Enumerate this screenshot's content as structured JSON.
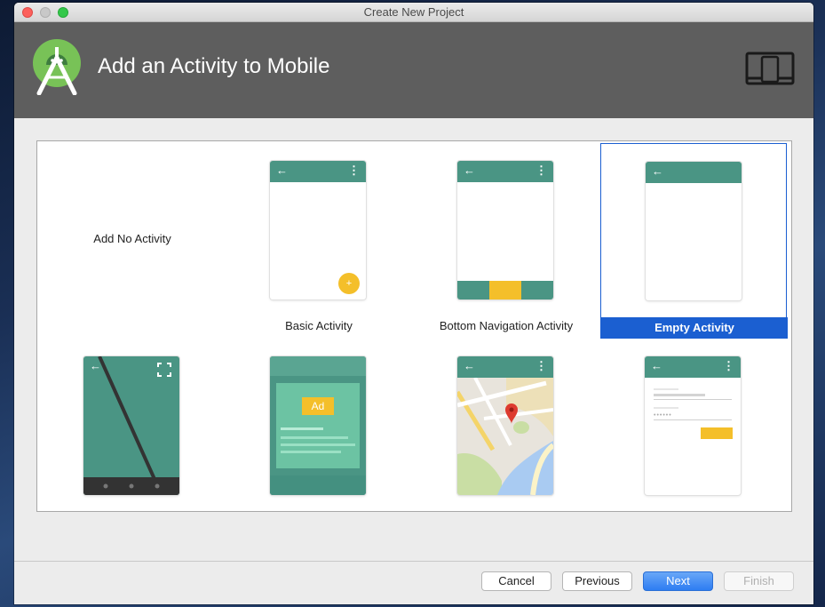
{
  "window": {
    "title": "Create New Project"
  },
  "header": {
    "title": "Add an Activity to Mobile",
    "logo_icon": "android-studio-logo-icon",
    "form_factor_icon": "mobile-device-icon"
  },
  "gallery": {
    "no_activity_label": "Add No Activity",
    "items": [
      {
        "label": "Basic Activity",
        "fab_text": "+"
      },
      {
        "label": "Bottom Navigation Activity"
      },
      {
        "label": "Empty Activity",
        "selected": true
      },
      {
        "label": ""
      },
      {
        "label": "",
        "ad_text": "Ad"
      },
      {
        "label": ""
      },
      {
        "label": ""
      }
    ]
  },
  "footer": {
    "cancel_label": "Cancel",
    "previous_label": "Previous",
    "next_label": "Next",
    "finish_label": "Finish"
  },
  "colors": {
    "accent": "#4a9584",
    "selection": "#1b5fd1",
    "fab": "#f4bf2a",
    "banner": "#5e5e5e"
  }
}
